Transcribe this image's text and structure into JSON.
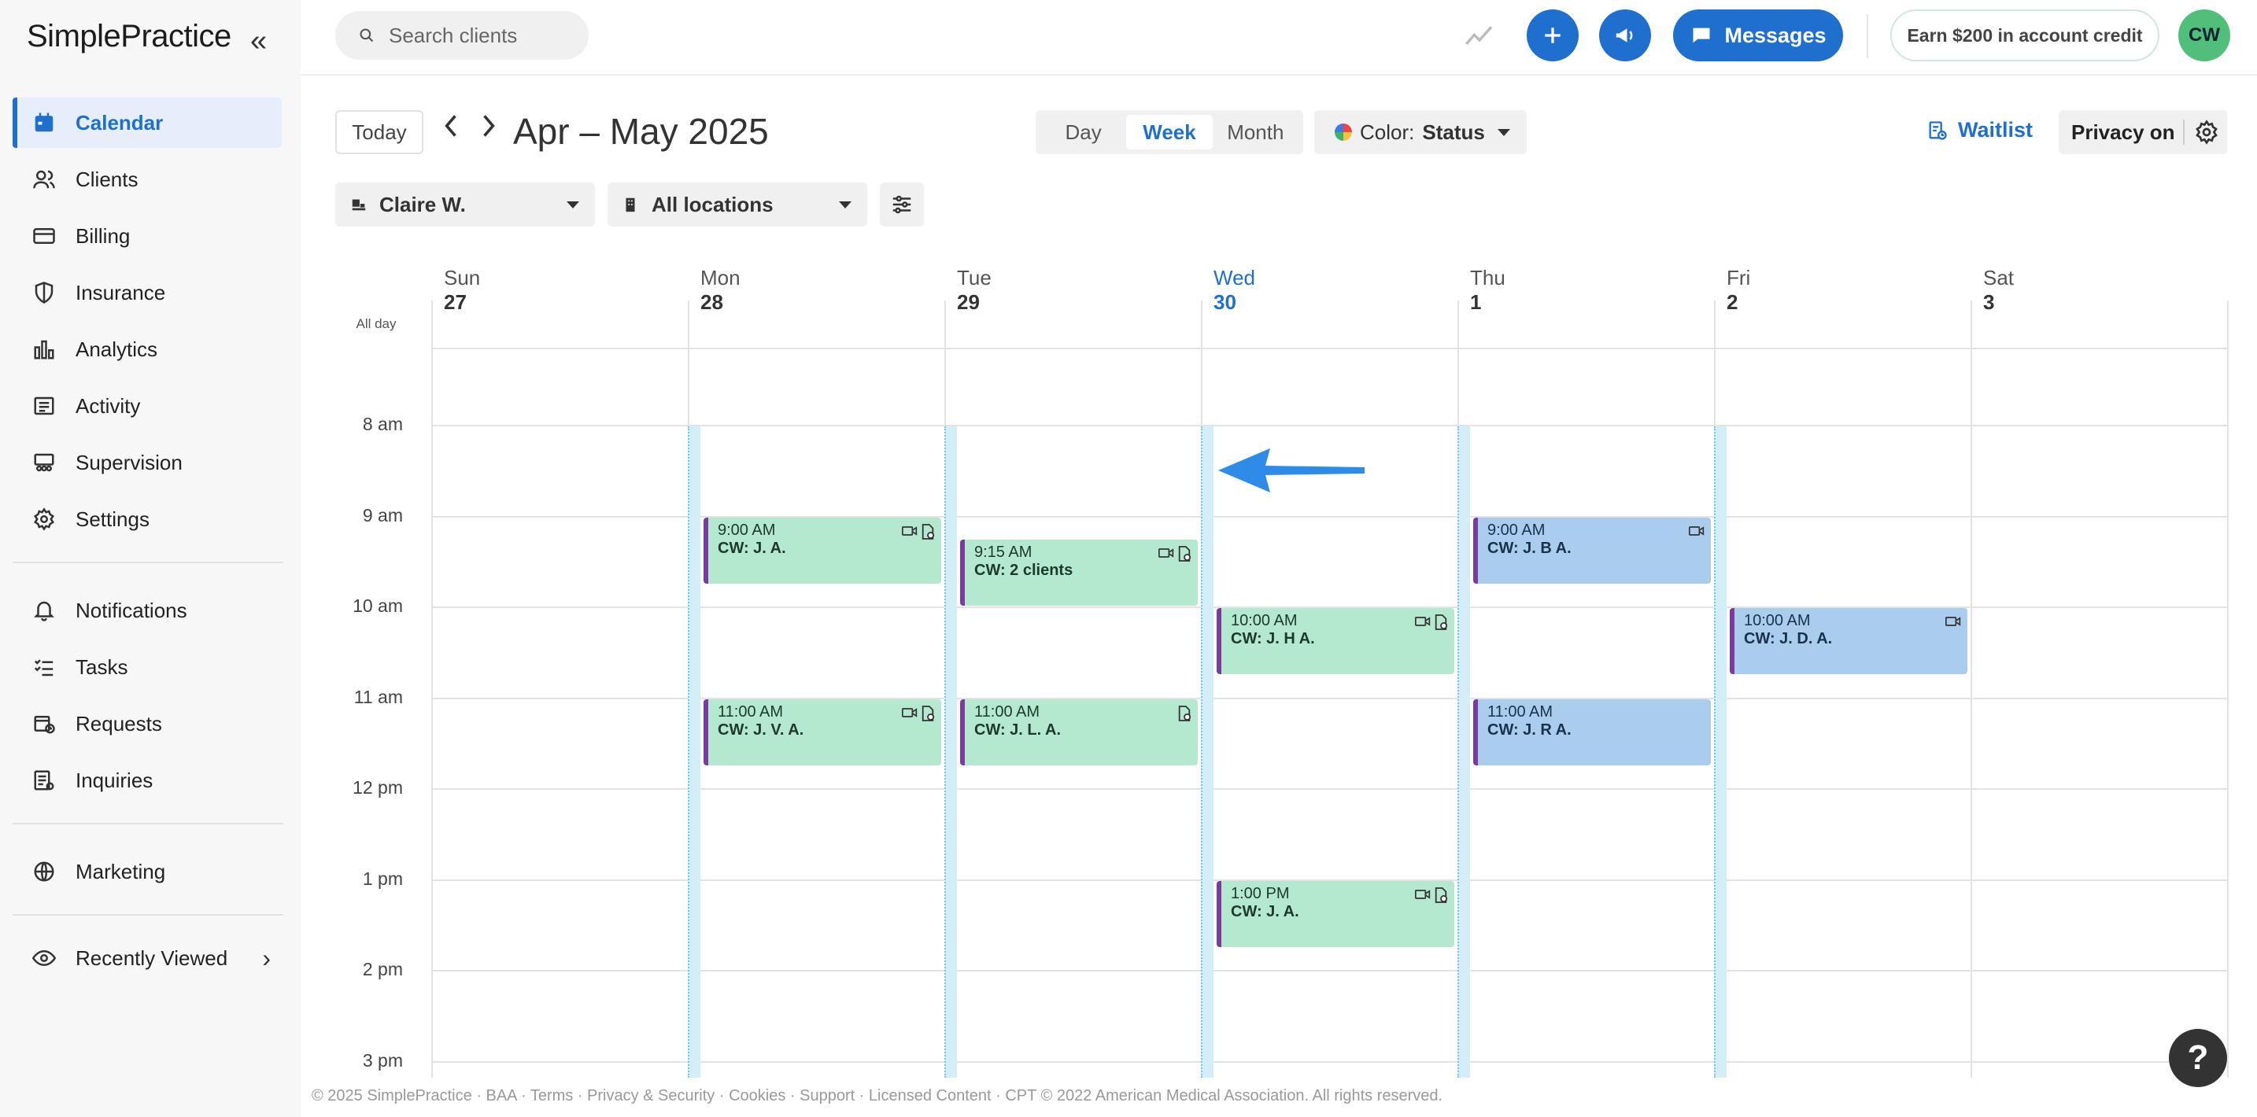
{
  "brand": {
    "name": "SimplePractice"
  },
  "sidebar": {
    "items": [
      {
        "label": "Calendar",
        "icon": "calendar-icon",
        "active": true
      },
      {
        "label": "Clients",
        "icon": "clients-icon"
      },
      {
        "label": "Billing",
        "icon": "billing-card-icon"
      },
      {
        "label": "Insurance",
        "icon": "shield-icon"
      },
      {
        "label": "Analytics",
        "icon": "bar-chart-icon"
      },
      {
        "label": "Activity",
        "icon": "activity-list-icon"
      },
      {
        "label": "Supervision",
        "icon": "supervision-icon"
      },
      {
        "label": "Settings",
        "icon": "gear-icon"
      },
      {
        "label": "Notifications",
        "icon": "bell-icon"
      },
      {
        "label": "Tasks",
        "icon": "tasks-icon"
      },
      {
        "label": "Requests",
        "icon": "requests-calendar-icon"
      },
      {
        "label": "Inquiries",
        "icon": "inquiries-icon"
      },
      {
        "label": "Marketing",
        "icon": "globe-icon"
      },
      {
        "label": "Recently Viewed",
        "icon": "eye-icon"
      }
    ]
  },
  "topbar": {
    "search_placeholder": "Search clients",
    "messages_label": "Messages",
    "earn_label": "Earn $200 in account credit",
    "avatar_initials": "CW"
  },
  "toolbar": {
    "today_label": "Today",
    "date_range": "Apr – May 2025",
    "views": [
      "Day",
      "Week",
      "Month"
    ],
    "active_view": "Week",
    "color_prefix": "Color:",
    "color_value": "Status",
    "waitlist_label": "Waitlist",
    "privacy_label": "Privacy on",
    "clinician": "Claire W.",
    "location": "All locations"
  },
  "calendar": {
    "all_day_label": "All day",
    "days": [
      {
        "dow": "Sun",
        "num": "27"
      },
      {
        "dow": "Mon",
        "num": "28"
      },
      {
        "dow": "Tue",
        "num": "29"
      },
      {
        "dow": "Wed",
        "num": "30",
        "today": true
      },
      {
        "dow": "Thu",
        "num": "1"
      },
      {
        "dow": "Fri",
        "num": "2"
      },
      {
        "dow": "Sat",
        "num": "3"
      }
    ],
    "hours": [
      "8 am",
      "9 am",
      "10 am",
      "11 am",
      "12 pm",
      "1 pm",
      "2 pm",
      "3 pm"
    ],
    "appointments": [
      {
        "day": 1,
        "time": "9:00 AM",
        "title": "CW: J. A.",
        "color": "green",
        "icons": [
          "video-icon",
          "document-icon"
        ]
      },
      {
        "day": 2,
        "time": "9:15 AM",
        "title": "CW: 2 clients",
        "color": "green",
        "icons": [
          "video-icon",
          "document-icon"
        ]
      },
      {
        "day": 4,
        "time": "9:00 AM",
        "title": "CW: J. B A.",
        "color": "blue",
        "icons": [
          "video-icon"
        ]
      },
      {
        "day": 3,
        "time": "10:00 AM",
        "title": "CW: J. H A.",
        "color": "green",
        "icons": [
          "video-icon",
          "document-icon"
        ]
      },
      {
        "day": 5,
        "time": "10:00 AM",
        "title": "CW: J. D. A.",
        "color": "blue",
        "icons": [
          "video-icon"
        ]
      },
      {
        "day": 1,
        "time": "11:00 AM",
        "title": "CW: J. V. A.",
        "color": "green",
        "icons": [
          "video-icon",
          "document-icon"
        ]
      },
      {
        "day": 2,
        "time": "11:00 AM",
        "title": "CW: J. L. A.",
        "color": "green",
        "icons": [
          "document-icon"
        ]
      },
      {
        "day": 4,
        "time": "11:00 AM",
        "title": "CW: J. R A.",
        "color": "blue",
        "icons": []
      },
      {
        "day": 3,
        "time": "1:00 PM",
        "title": "CW: J. A.",
        "color": "green",
        "icons": [
          "video-icon",
          "document-icon"
        ]
      }
    ]
  },
  "footer": {
    "text": "© 2025 SimplePractice · BAA · Terms · Privacy & Security · Cookies · Support · Licensed Content · CPT © 2022 American Medical Association. All rights reserved."
  },
  "help_label": "?"
}
